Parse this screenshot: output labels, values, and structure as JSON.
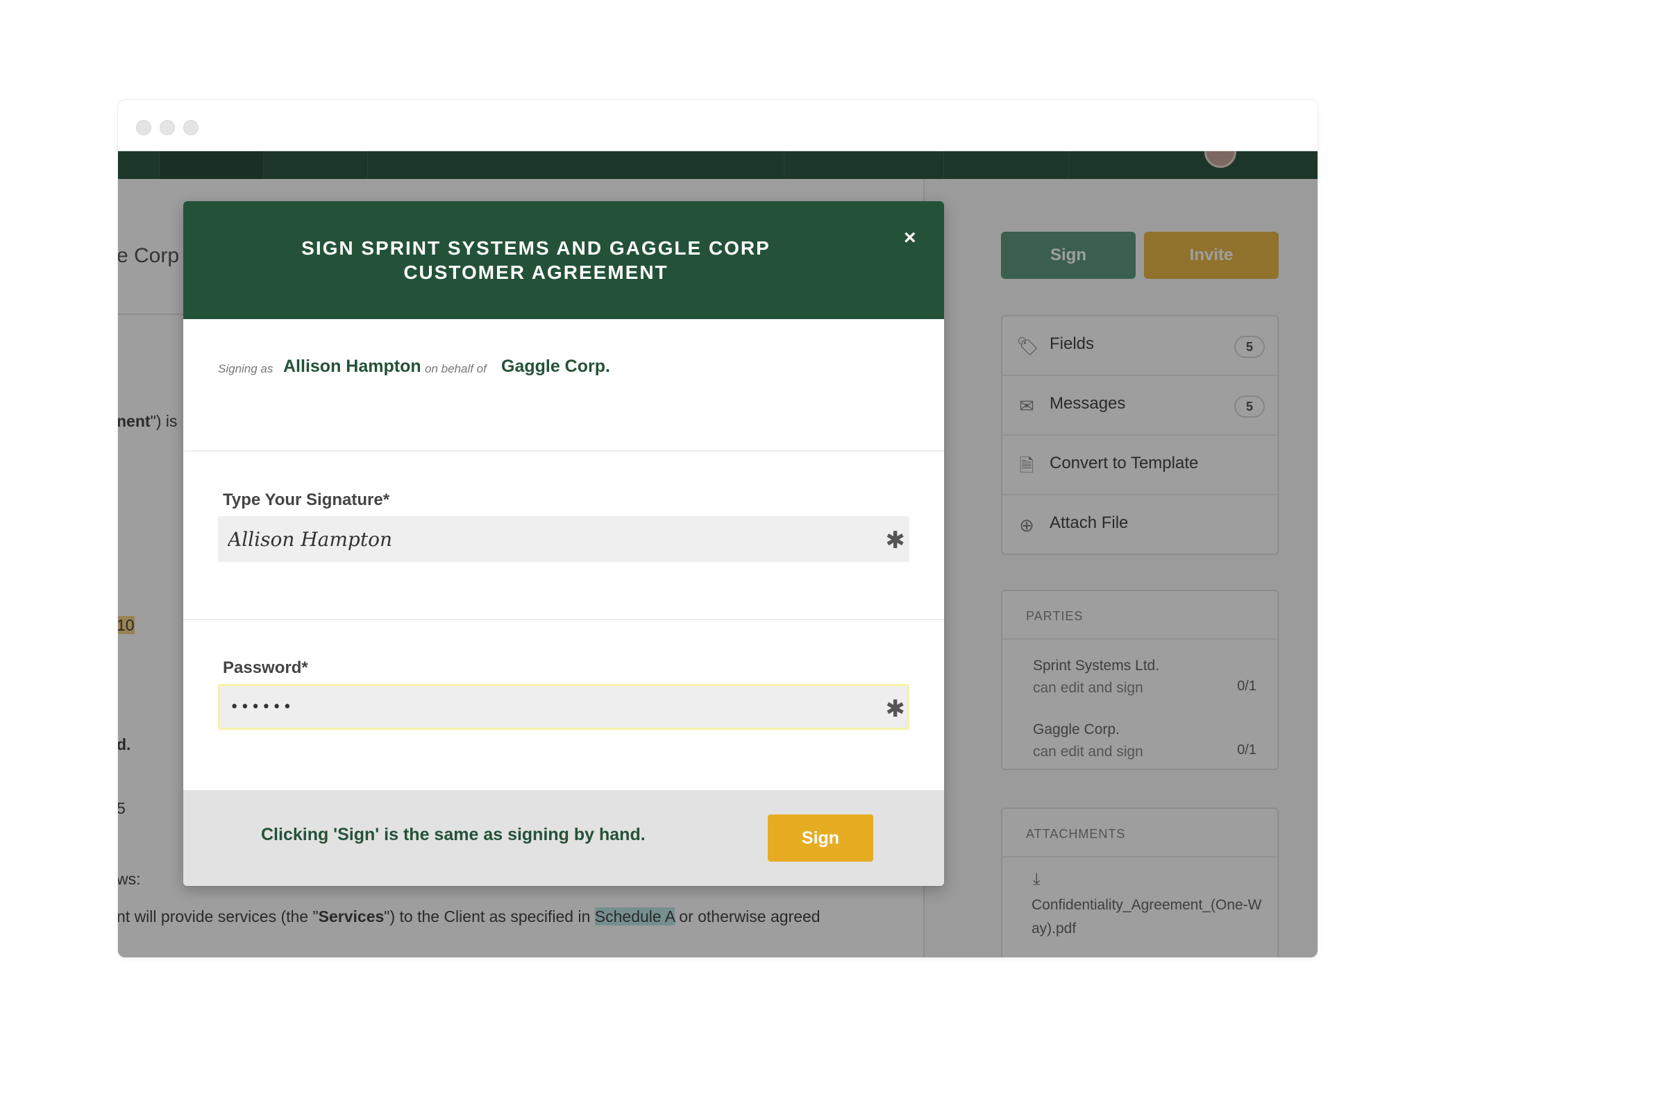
{
  "background": {
    "doc_title_fragment": "e Corp",
    "doc_lines": [
      {
        "parts": [
          {
            "text": "nent",
            "bold": true
          },
          {
            "text": "\") is"
          }
        ]
      },
      {
        "parts": [
          {
            "text": "10",
            "highlight": "yellow"
          }
        ]
      },
      {
        "parts": [
          {
            "text": "d.",
            "bold": true
          }
        ]
      },
      {
        "parts": [
          {
            "text": "5"
          }
        ]
      },
      {
        "parts": [
          {
            "text": "ws:"
          }
        ]
      },
      {
        "parts": [
          {
            "text": "nt will provide services (the \""
          },
          {
            "text": "Services",
            "bold": true
          },
          {
            "text": "\") to the Client as specified in "
          },
          {
            "text": "Schedule A",
            "highlight": "teal"
          },
          {
            "text": " or otherwise agreed"
          }
        ]
      }
    ],
    "sidebar": {
      "sign_label": "Sign",
      "invite_label": "Invite",
      "menu": [
        {
          "label": "Fields",
          "count": "5",
          "icon": "tag-icon"
        },
        {
          "label": "Messages",
          "count": "5",
          "icon": "envelope-icon"
        },
        {
          "label": "Convert to Template",
          "count": "",
          "icon": "file-icon"
        },
        {
          "label": "Attach File",
          "count": "",
          "icon": "upload-icon"
        }
      ],
      "parties_heading": "PARTIES",
      "parties": [
        {
          "name": "Sprint Systems Ltd.",
          "role": "can edit and sign",
          "count": "0/1"
        },
        {
          "name": "Gaggle Corp.",
          "role": "can edit and sign",
          "count": "0/1"
        }
      ],
      "attachments_heading": "ATTACHMENTS",
      "attachment_file": "Confidentiality_Agreement_(One-Way).pdf"
    }
  },
  "modal": {
    "title": "SIGN SPRINT SYSTEMS AND GAGGLE CORP CUSTOMER AGREEMENT",
    "close_label": "×",
    "signing_as_label": "Signing as",
    "signer_name": "Allison Hampton",
    "on_behalf_label": "on behalf of",
    "company_name": "Gaggle Corp.",
    "signature": {
      "label": "Type Your Signature*",
      "value": "Allison Hampton",
      "required_mark": "✱"
    },
    "password": {
      "label": "Password*",
      "value": "••••••",
      "required_mark": "✱"
    },
    "footer_text": "Clicking 'Sign' is the same as signing by hand.",
    "sign_button": "Sign"
  },
  "colors": {
    "header_green": "#245238",
    "accent_yellow": "#e6ac22",
    "nav_green": "#2e5a44"
  }
}
